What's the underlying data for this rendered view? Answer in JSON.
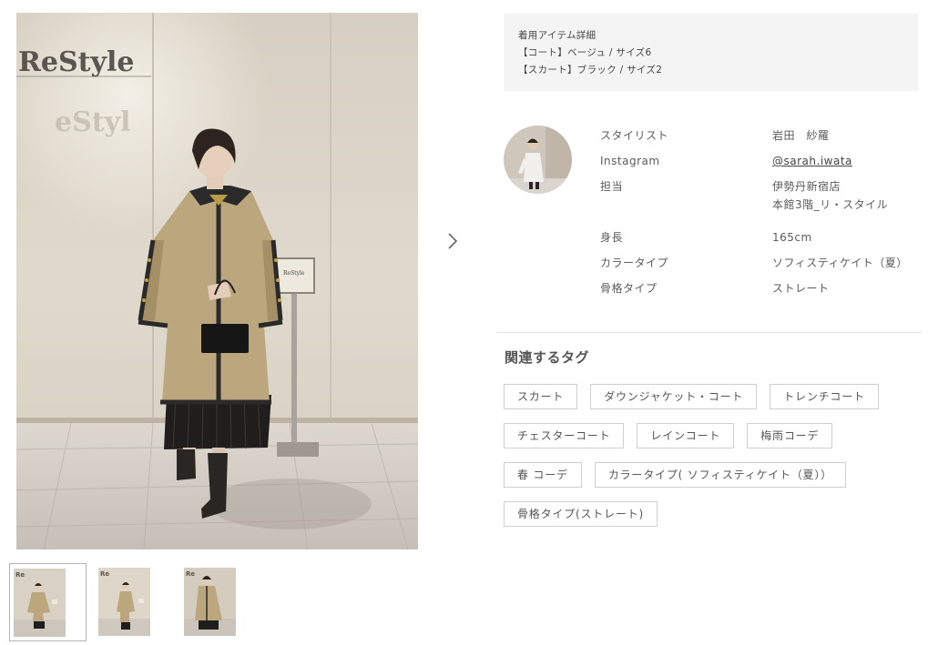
{
  "item_details": {
    "heading": "着用アイテム詳細",
    "items": [
      "【コート】ベージュ / サイズ6",
      "【スカート】ブラック / サイズ2"
    ]
  },
  "photo": {
    "store_logo": "ReStyle",
    "sign_logo": "ReStyle"
  },
  "stylist": {
    "rows": [
      {
        "label": "スタイリスト",
        "value": "岩田　紗羅"
      },
      {
        "label": "Instagram",
        "value": "@sarah.iwata"
      },
      {
        "label": "担当",
        "value": "伊勢丹新宿店",
        "value2": "本館3階_リ・スタイル"
      },
      {
        "label": "身長",
        "value": "165cm"
      },
      {
        "label": "カラータイプ",
        "value": "ソフィスティケイト（夏）"
      },
      {
        "label": "骨格タイプ",
        "value": "ストレート"
      }
    ]
  },
  "tags": {
    "title": "関連するタグ",
    "items": [
      "スカート",
      "ダウンジャケット・コート",
      "トレンチコート",
      "チェスターコート",
      "レインコート",
      "梅雨コーデ",
      "春 コーデ",
      "カラータイプ( ソフィスティケイト（夏））",
      "骨格タイプ(ストレート)"
    ]
  },
  "gallery": {
    "icons": {
      "next": "chevron-right-icon"
    },
    "thumbnail_count": 3,
    "active_index": 0
  },
  "colors": {
    "coat": "#b9a57f",
    "trim": "#2a2a2a",
    "wall": "#d8d1c4",
    "floor": "#cfc9c2",
    "panel_bg": "#f4f4f4"
  }
}
